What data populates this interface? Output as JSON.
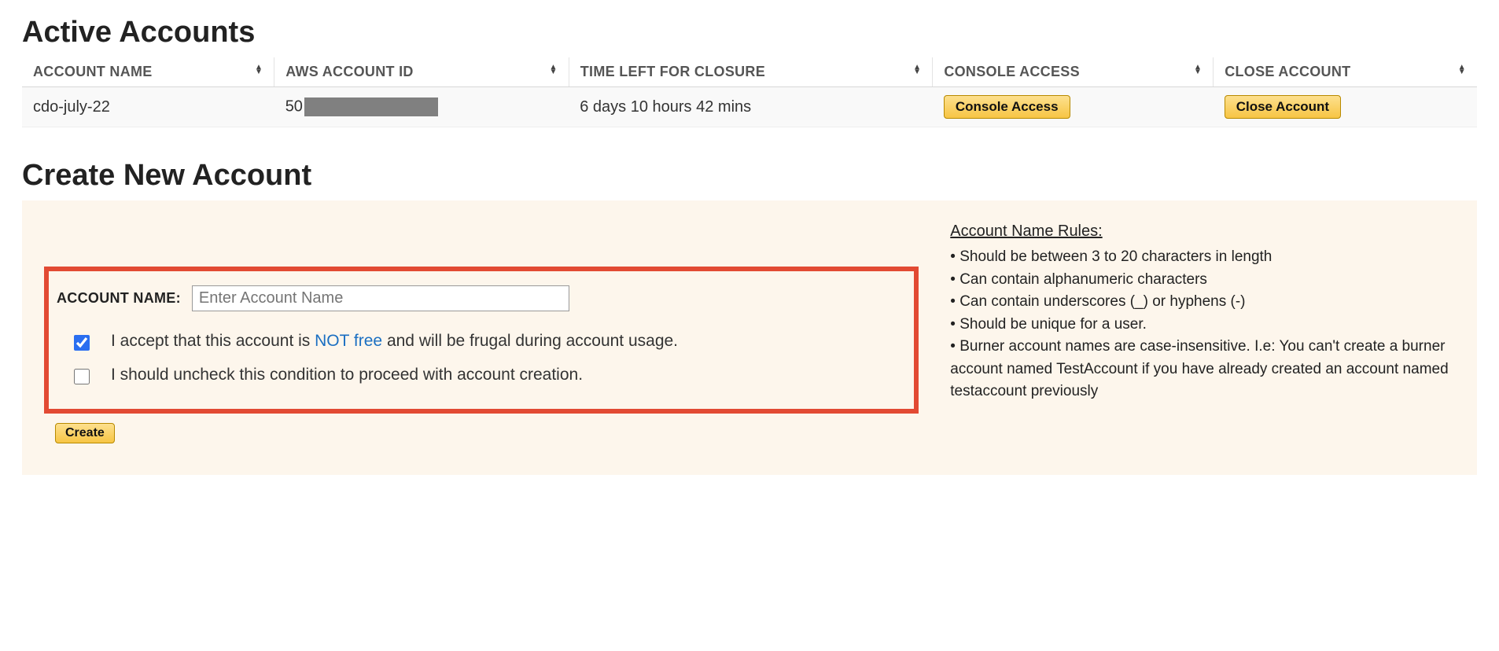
{
  "active": {
    "heading": "Active Accounts",
    "columns": [
      "ACCOUNT NAME",
      "AWS ACCOUNT ID",
      "TIME LEFT FOR CLOSURE",
      "CONSOLE ACCESS",
      "CLOSE ACCOUNT"
    ],
    "rows": [
      {
        "name": "cdo-july-22",
        "aws_id_prefix": "50",
        "time_left": "6 days 10 hours 42 mins",
        "console_btn": "Console Access",
        "close_btn": "Close Account"
      }
    ]
  },
  "create": {
    "heading": "Create New Account",
    "name_label": "ACCOUNT NAME:",
    "name_placeholder": "Enter Account Name",
    "accept_pre": "I accept that this account is ",
    "accept_mid": "NOT free",
    "accept_post": " and will be frugal during account usage.",
    "uncheck_text": "I should uncheck this condition to proceed with account creation.",
    "create_btn": "Create",
    "accept_checked": true,
    "uncheck_checked": false
  },
  "rules": {
    "title": "Account Name Rules:",
    "items": [
      "Should be between 3 to 20 characters in length",
      "Can contain alphanumeric characters",
      "Can contain underscores (_) or hyphens (-)",
      "Should be unique for a user.",
      "Burner account names are case-insensitive. I.e: You can't create a burner account named TestAccount if you have already created an account named testaccount previously"
    ]
  }
}
